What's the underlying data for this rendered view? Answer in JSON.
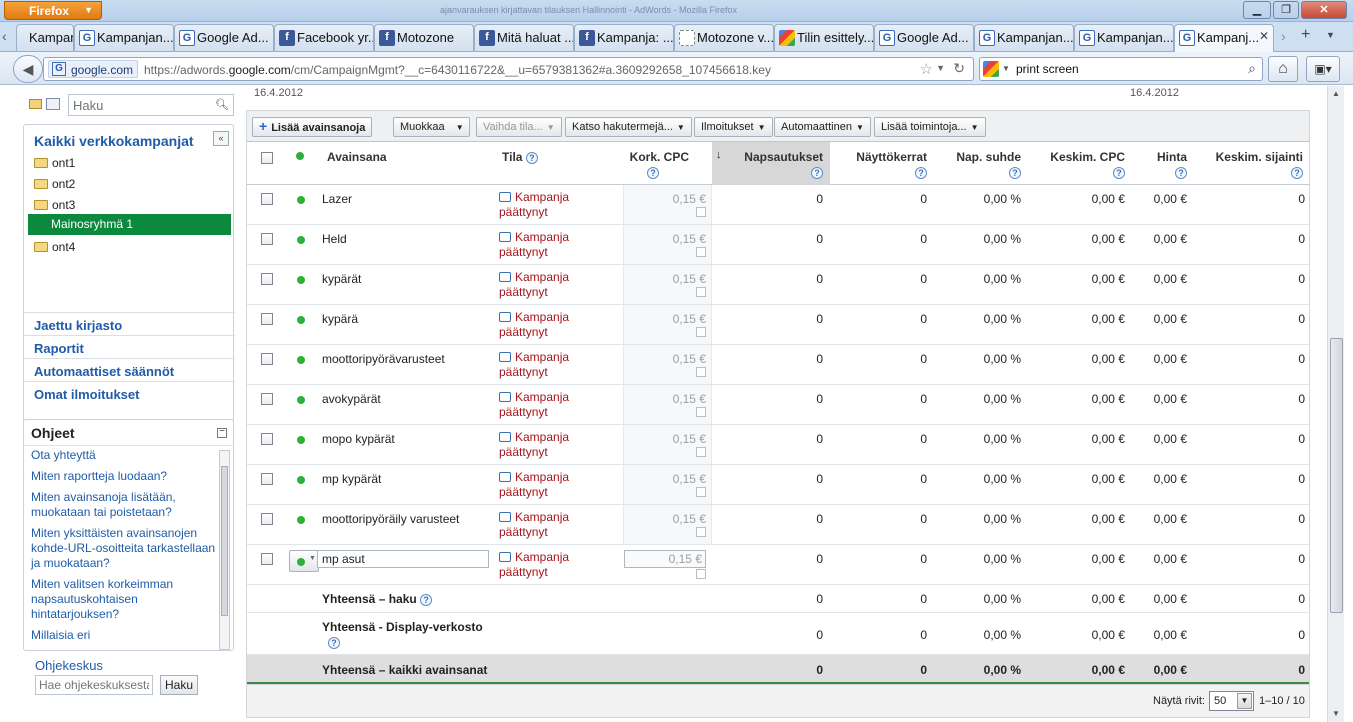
{
  "browser": {
    "menu_label": "Firefox",
    "window_title": "ajanvarauksen kirjattavan tilauksen Hallinnointi - AdWords - Mozilla Firefox",
    "tabs": [
      {
        "label": "Kampanjan...",
        "icon": "page-icon"
      },
      {
        "label": "Kampanjan...",
        "icon": "google-icon"
      },
      {
        "label": "Google Ad...",
        "icon": "google-icon"
      },
      {
        "label": "Facebook yr...",
        "icon": "facebook-icon"
      },
      {
        "label": "Motozone",
        "icon": "facebook-icon"
      },
      {
        "label": "Mitä haluat ...",
        "icon": "facebook-icon"
      },
      {
        "label": "Kampanja: ...",
        "icon": "facebook-icon"
      },
      {
        "label": "Motozone v...",
        "icon": "blank-page-icon"
      },
      {
        "label": "Tilin esittely...",
        "icon": "google-color-icon"
      },
      {
        "label": "Google Ad...",
        "icon": "google-icon"
      },
      {
        "label": "Kampanjan...",
        "icon": "google-icon"
      },
      {
        "label": "Kampanjan...",
        "icon": "google-icon"
      },
      {
        "label": "Kampanj...",
        "icon": "google-icon"
      }
    ],
    "site_label": "google.com",
    "url_prefix": "https://adwords.",
    "url_domain": "google.com",
    "url_rest": "/cm/CampaignMgmt?__c=6430116722&__u=6579381362#a.3609292658_107456618.key",
    "search_query": "print screen"
  },
  "sidebar": {
    "search_placeholder": "Haku",
    "campaigns_header": "Kaikki verkkokampanjat",
    "tree": [
      "ont1",
      "ont2",
      "ont3",
      "Mainosryhmä 1",
      "ont4"
    ],
    "links": [
      "Jaettu kirjasto",
      "Raportit",
      "Automaattiset säännöt",
      "Omat ilmoitukset"
    ],
    "help_header": "Ohjeet",
    "help_links": [
      "Ota yhteyttä",
      "Miten raportteja luodaan?",
      "Miten avainsanoja lisätään, muokataan tai poistetaan?",
      "Miten yksittäisten avainsanojen kohde-URL-osoitteita tarkastellaan ja muokataan?",
      "Miten valitsen korkeimman napsautuskohtaisen hintatarjouksen?",
      "Millaisia eri"
    ],
    "help_center_label": "Ohjekeskus",
    "help_search_placeholder": "Hae ohjekeskuksesta",
    "help_search_button": "Haku"
  },
  "main": {
    "date_left": "16.4.2012",
    "date_right": "16.4.2012",
    "toolbar": {
      "add": "Lisää avainsanoja",
      "edit": "Muokkaa",
      "change_status": "Vaihda tila...",
      "search_terms": "Katso hakutermejä...",
      "alerts": "Ilmoitukset",
      "automate": "Automaattinen",
      "more": "Lisää toimintoja..."
    },
    "columns": {
      "keyword": "Avainsana",
      "status": "Tila",
      "max_cpc": "Kork. CPC",
      "clicks": "Napsautukset",
      "impressions": "Näyttökerrat",
      "ctr": "Nap. suhde",
      "avg_cpc": "Keskim. CPC",
      "cost": "Hinta",
      "avg_pos": "Keskim. sijainti"
    },
    "rows": [
      {
        "keyword": "Lazer",
        "status1": "Kampanja",
        "status2": "päättynyt",
        "cpc": "0,15 €",
        "clicks": "0",
        "impr": "0",
        "ctr": "0,00 %",
        "avg_cpc": "0,00 €",
        "cost": "0,00 €",
        "pos": "0"
      },
      {
        "keyword": "Held",
        "status1": "Kampanja",
        "status2": "päättynyt",
        "cpc": "0,15 €",
        "clicks": "0",
        "impr": "0",
        "ctr": "0,00 %",
        "avg_cpc": "0,00 €",
        "cost": "0,00 €",
        "pos": "0"
      },
      {
        "keyword": "kypärät",
        "status1": "Kampanja",
        "status2": "päättynyt",
        "cpc": "0,15 €",
        "clicks": "0",
        "impr": "0",
        "ctr": "0,00 %",
        "avg_cpc": "0,00 €",
        "cost": "0,00 €",
        "pos": "0"
      },
      {
        "keyword": "kypärä",
        "status1": "Kampanja",
        "status2": "päättynyt",
        "cpc": "0,15 €",
        "clicks": "0",
        "impr": "0",
        "ctr": "0,00 %",
        "avg_cpc": "0,00 €",
        "cost": "0,00 €",
        "pos": "0"
      },
      {
        "keyword": "moottoripyörävarusteet",
        "status1": "Kampanja",
        "status2": "päättynyt",
        "cpc": "0,15 €",
        "clicks": "0",
        "impr": "0",
        "ctr": "0,00 %",
        "avg_cpc": "0,00 €",
        "cost": "0,00 €",
        "pos": "0"
      },
      {
        "keyword": "avokypärät",
        "status1": "Kampanja",
        "status2": "päättynyt",
        "cpc": "0,15 €",
        "clicks": "0",
        "impr": "0",
        "ctr": "0,00 %",
        "avg_cpc": "0,00 €",
        "cost": "0,00 €",
        "pos": "0"
      },
      {
        "keyword": "mopo kypärät",
        "status1": "Kampanja",
        "status2": "päättynyt",
        "cpc": "0,15 €",
        "clicks": "0",
        "impr": "0",
        "ctr": "0,00 %",
        "avg_cpc": "0,00 €",
        "cost": "0,00 €",
        "pos": "0"
      },
      {
        "keyword": "mp kypärät",
        "status1": "Kampanja",
        "status2": "päättynyt",
        "cpc": "0,15 €",
        "clicks": "0",
        "impr": "0",
        "ctr": "0,00 %",
        "avg_cpc": "0,00 €",
        "cost": "0,00 €",
        "pos": "0"
      },
      {
        "keyword": "moottoripyöräily varusteet",
        "status1": "Kampanja",
        "status2": "päättynyt",
        "cpc": "0,15 €",
        "clicks": "0",
        "impr": "0",
        "ctr": "0,00 %",
        "avg_cpc": "0,00 €",
        "cost": "0,00 €",
        "pos": "0"
      },
      {
        "keyword": "mp asut",
        "status1": "Kampanja",
        "status2": "päättynyt",
        "cpc": "0,15 €",
        "clicks": "0",
        "impr": "0",
        "ctr": "0,00 %",
        "avg_cpc": "0,00 €",
        "cost": "0,00 €",
        "pos": "0"
      }
    ],
    "totals": [
      {
        "label": "Yhteensä – haku",
        "clicks": "0",
        "impr": "0",
        "ctr": "0,00 %",
        "avg_cpc": "0,00 €",
        "cost": "0,00 €",
        "pos": "0"
      },
      {
        "label": "Yhteensä - Display-verkosto",
        "clicks": "0",
        "impr": "0",
        "ctr": "0,00 %",
        "avg_cpc": "0,00 €",
        "cost": "0,00 €",
        "pos": "0"
      },
      {
        "label": "Yhteensä – kaikki avainsanat",
        "clicks": "0",
        "impr": "0",
        "ctr": "0,00 %",
        "avg_cpc": "0,00 €",
        "cost": "0,00 €",
        "pos": "0"
      }
    ],
    "footer": {
      "rows_label": "Näytä rivit:",
      "rows_value": "50",
      "range": "1–10 / 10"
    }
  }
}
